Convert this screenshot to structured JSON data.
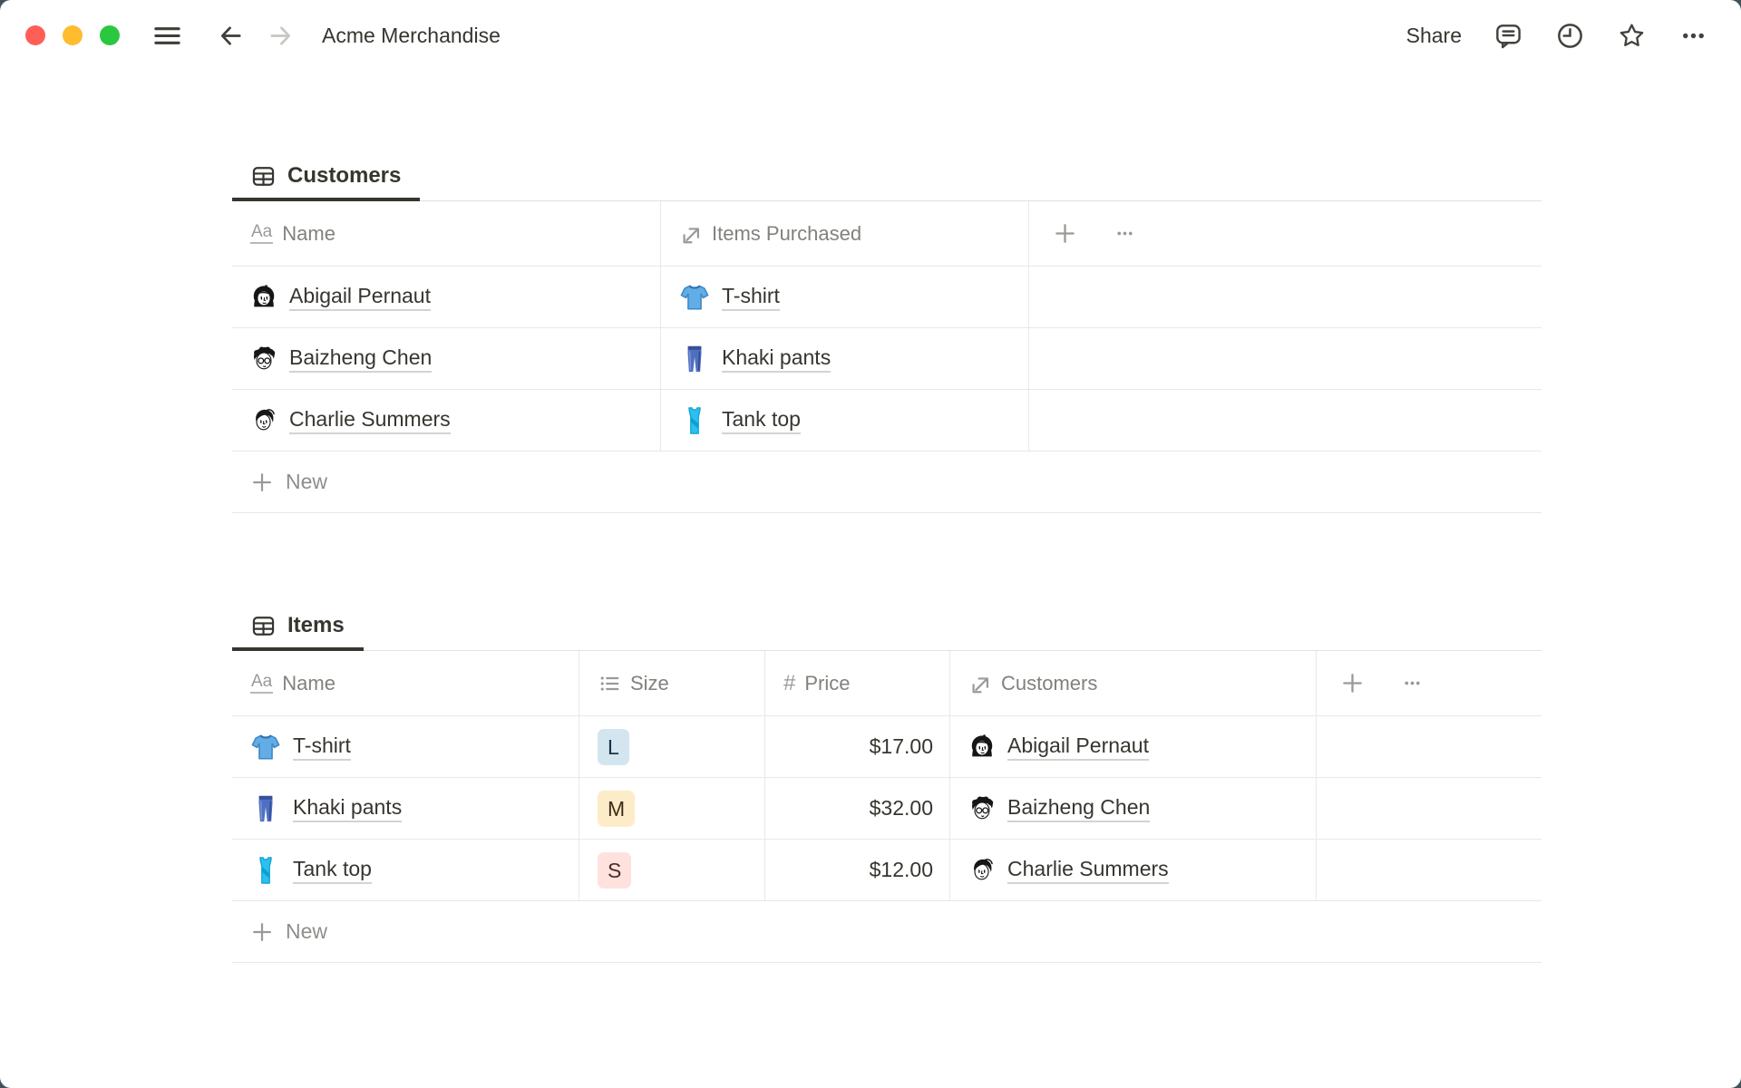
{
  "topbar": {
    "title": "Acme Merchandise",
    "share_label": "Share",
    "traffic_lights": [
      "close",
      "minimize",
      "fullscreen"
    ],
    "icon_names": [
      "menu-icon",
      "back-arrow-icon",
      "forward-arrow-icon",
      "comment-bubble-icon",
      "clock-history-icon",
      "star-favorite-icon",
      "more-ellipsis-icon"
    ]
  },
  "colors": {
    "text_primary": "#37352f",
    "text_secondary": "#82817d",
    "tab_underline": "#37352f",
    "divider": "#e9e8e6",
    "tag_blue_bg": "#d3e5ef",
    "tag_yellow_bg": "#fdecc8",
    "tag_red_bg": "#ffe2dd",
    "traffic_red": "#ff5f57",
    "traffic_yellow": "#febc2e",
    "traffic_green": "#2ac840"
  },
  "customers_table": {
    "tab_label": "Customers",
    "tab_icon": "table-view-icon",
    "columns": [
      {
        "label": "Name",
        "icon": "title-icon"
      },
      {
        "label": "Items Purchased",
        "icon": "relation-icon"
      }
    ],
    "rows": [
      {
        "name": "Abigail Pernaut",
        "avatar_icon": "avatar-abigail-pernaut-icon",
        "item": "T-shirt",
        "item_icon": "tshirt-emoji-icon"
      },
      {
        "name": "Baizheng Chen",
        "avatar_icon": "avatar-baizheng-chen-icon",
        "item": "Khaki pants",
        "item_icon": "jeans-emoji-icon"
      },
      {
        "name": "Charlie Summers",
        "avatar_icon": "avatar-charlie-summers-icon",
        "item": "Tank top",
        "item_icon": "tank-top-emoji-icon"
      }
    ],
    "new_row_label": "New"
  },
  "items_table": {
    "tab_label": "Items",
    "tab_icon": "table-view-icon",
    "columns": [
      {
        "label": "Name",
        "icon": "title-icon"
      },
      {
        "label": "Size",
        "icon": "select-icon"
      },
      {
        "label": "Price",
        "icon": "number-icon"
      },
      {
        "label": "Customers",
        "icon": "relation-icon"
      }
    ],
    "rows": [
      {
        "name": "T-shirt",
        "item_icon": "tshirt-emoji-icon",
        "size": "L",
        "size_tag_color": "#d3e5ef",
        "price": "$17.00",
        "customer": "Abigail Pernaut",
        "customer_avatar_icon": "avatar-abigail-pernaut-icon"
      },
      {
        "name": "Khaki pants",
        "item_icon": "jeans-emoji-icon",
        "size": "M",
        "size_tag_color": "#fdecc8",
        "price": "$32.00",
        "customer": "Baizheng Chen",
        "customer_avatar_icon": "avatar-baizheng-chen-icon"
      },
      {
        "name": "Tank top",
        "item_icon": "tank-top-emoji-icon",
        "size": "S",
        "size_tag_color": "#ffe2dd",
        "price": "$12.00",
        "customer": "Charlie Summers",
        "customer_avatar_icon": "avatar-charlie-summers-icon"
      }
    ],
    "new_row_label": "New"
  }
}
